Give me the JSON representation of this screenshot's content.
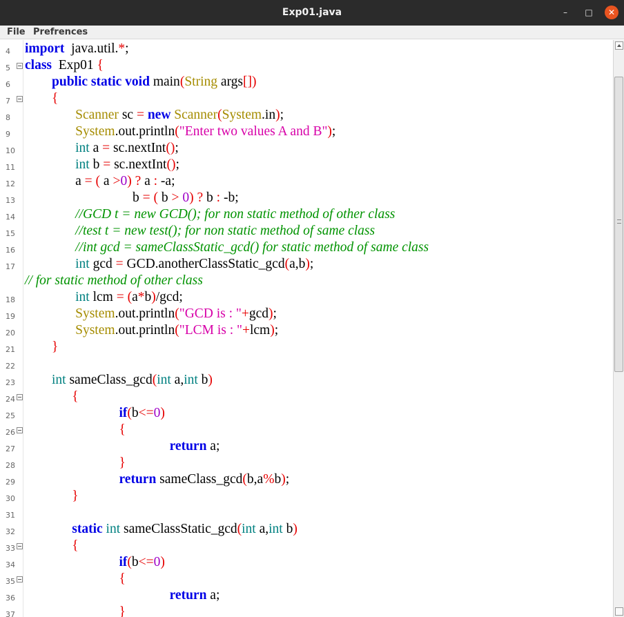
{
  "window": {
    "title": "Exp01.java",
    "minimize_glyph": "–",
    "maximize_glyph": "□",
    "close_glyph": "✕",
    "close_color": "#e95420"
  },
  "menu": {
    "file": "File",
    "prefs": "Prefrences"
  },
  "syntax_colors": {
    "keyword": "#0000e6",
    "type": "#008080",
    "class": "#a58c00",
    "symbol": "#e60000",
    "string": "#d700a8",
    "number": "#9e00c7",
    "comment": "#009300"
  },
  "lines": [
    {
      "num": "4",
      "fold": false,
      "tokens": [
        [
          "kw",
          "import"
        ],
        [
          "",
          "  java.util."
        ],
        [
          "sym",
          "*"
        ],
        [
          "",
          ";"
        ]
      ]
    },
    {
      "num": "5",
      "fold": true,
      "tokens": [
        [
          "kw",
          "class"
        ],
        [
          "",
          "  Exp01 "
        ],
        [
          "sym",
          "{"
        ]
      ]
    },
    {
      "num": "6",
      "fold": false,
      "tokens": [
        [
          "",
          "        "
        ],
        [
          "kw",
          "public static void"
        ],
        [
          "",
          " main"
        ],
        [
          "sym",
          "("
        ],
        [
          "cls",
          "String"
        ],
        [
          "",
          " args"
        ],
        [
          "sym",
          "[])"
        ]
      ]
    },
    {
      "num": "7",
      "fold": true,
      "tokens": [
        [
          "",
          "        "
        ],
        [
          "sym",
          "{"
        ]
      ]
    },
    {
      "num": "8",
      "fold": false,
      "tokens": [
        [
          "",
          "               "
        ],
        [
          "cls",
          "Scanner"
        ],
        [
          "",
          " sc "
        ],
        [
          "sym",
          "="
        ],
        [
          "",
          " "
        ],
        [
          "kw",
          "new"
        ],
        [
          "",
          " "
        ],
        [
          "cls",
          "Scanner"
        ],
        [
          "sym",
          "("
        ],
        [
          "cls",
          "System"
        ],
        [
          "",
          ".in"
        ],
        [
          "sym",
          ")"
        ],
        [
          "",
          ";"
        ]
      ]
    },
    {
      "num": "9",
      "fold": false,
      "tokens": [
        [
          "",
          "               "
        ],
        [
          "cls",
          "System"
        ],
        [
          "",
          ".out.println"
        ],
        [
          "sym",
          "("
        ],
        [
          "str",
          "\"Enter two values A and B\""
        ],
        [
          "sym",
          ")"
        ],
        [
          "",
          ";"
        ]
      ]
    },
    {
      "num": "10",
      "fold": false,
      "tokens": [
        [
          "",
          "               "
        ],
        [
          "ty",
          "int"
        ],
        [
          "",
          " a "
        ],
        [
          "sym",
          "="
        ],
        [
          "",
          " sc.nextInt"
        ],
        [
          "sym",
          "()"
        ],
        [
          "",
          ";"
        ]
      ]
    },
    {
      "num": "11",
      "fold": false,
      "tokens": [
        [
          "",
          "               "
        ],
        [
          "ty",
          "int"
        ],
        [
          "",
          " b "
        ],
        [
          "sym",
          "="
        ],
        [
          "",
          " sc.nextInt"
        ],
        [
          "sym",
          "()"
        ],
        [
          "",
          ";"
        ]
      ]
    },
    {
      "num": "12",
      "fold": false,
      "tokens": [
        [
          "",
          "               a "
        ],
        [
          "sym",
          "="
        ],
        [
          "",
          " "
        ],
        [
          "sym",
          "("
        ],
        [
          "",
          " a "
        ],
        [
          "sym",
          ">"
        ],
        [
          " ",
          ""
        ],
        [
          "num",
          "0"
        ],
        [
          "sym",
          ")"
        ],
        [
          "",
          " "
        ],
        [
          "sym",
          "?"
        ],
        [
          "",
          " a "
        ],
        [
          "sym",
          ":"
        ],
        [
          "",
          " -a;"
        ]
      ]
    },
    {
      "num": "13",
      "fold": false,
      "tokens": [
        [
          "",
          "                                b "
        ],
        [
          "sym",
          "="
        ],
        [
          "",
          " "
        ],
        [
          "sym",
          "("
        ],
        [
          "",
          " b "
        ],
        [
          "sym",
          ">"
        ],
        [
          "",
          " "
        ],
        [
          "num",
          "0"
        ],
        [
          "sym",
          ")"
        ],
        [
          "",
          " "
        ],
        [
          "sym",
          "?"
        ],
        [
          "",
          " b "
        ],
        [
          "sym",
          ":"
        ],
        [
          "",
          " -b;"
        ]
      ]
    },
    {
      "num": "14",
      "fold": false,
      "tokens": [
        [
          "",
          "               "
        ],
        [
          "cm",
          "//GCD t = new GCD(); for non static method of other class"
        ]
      ]
    },
    {
      "num": "15",
      "fold": false,
      "tokens": [
        [
          "",
          "               "
        ],
        [
          "cm",
          "//test t = new test(); for non static method of same class"
        ]
      ]
    },
    {
      "num": "16",
      "fold": false,
      "tokens": [
        [
          "",
          "               "
        ],
        [
          "cm",
          "//int gcd = sameClassStatic_gcd() for static method of same class"
        ]
      ]
    },
    {
      "num": "17",
      "fold": false,
      "tokens": [
        [
          "",
          "               "
        ],
        [
          "ty",
          "int"
        ],
        [
          "",
          " gcd "
        ],
        [
          "sym",
          "="
        ],
        [
          "",
          " GCD.anotherClassStatic_gcd"
        ],
        [
          "sym",
          "("
        ],
        [
          "",
          "a,b"
        ],
        [
          "sym",
          ")"
        ],
        [
          "",
          ";"
        ]
      ]
    },
    {
      "num": "",
      "fold": false,
      "wrap": true,
      "tokens": [
        [
          "cm",
          "// for static method of other class"
        ]
      ]
    },
    {
      "num": "18",
      "fold": false,
      "tokens": [
        [
          "",
          "               "
        ],
        [
          "ty",
          "int"
        ],
        [
          "",
          " lcm "
        ],
        [
          "sym",
          "="
        ],
        [
          "",
          " "
        ],
        [
          "sym",
          "("
        ],
        [
          "",
          "a"
        ],
        [
          "sym",
          "*"
        ],
        [
          "",
          "b"
        ],
        [
          "sym",
          ")"
        ],
        [
          "",
          "/gcd;"
        ]
      ]
    },
    {
      "num": "19",
      "fold": false,
      "tokens": [
        [
          "",
          "               "
        ],
        [
          "cls",
          "System"
        ],
        [
          "",
          ".out.println"
        ],
        [
          "sym",
          "("
        ],
        [
          "str",
          "\"GCD is : \""
        ],
        [
          "sym",
          "+"
        ],
        [
          "",
          "gcd"
        ],
        [
          "sym",
          ")"
        ],
        [
          "",
          ";"
        ]
      ]
    },
    {
      "num": "20",
      "fold": false,
      "tokens": [
        [
          "",
          "               "
        ],
        [
          "cls",
          "System"
        ],
        [
          "",
          ".out.println"
        ],
        [
          "sym",
          "("
        ],
        [
          "str",
          "\"LCM is : \""
        ],
        [
          "sym",
          "+"
        ],
        [
          "",
          "lcm"
        ],
        [
          "sym",
          ")"
        ],
        [
          "",
          ";"
        ]
      ]
    },
    {
      "num": "21",
      "fold": false,
      "tokens": [
        [
          "",
          "        "
        ],
        [
          "sym",
          "}"
        ]
      ]
    },
    {
      "num": "22",
      "fold": false,
      "tokens": []
    },
    {
      "num": "23",
      "fold": false,
      "tokens": [
        [
          "",
          "        "
        ],
        [
          "ty",
          "int"
        ],
        [
          "",
          " sameClass_gcd"
        ],
        [
          "sym",
          "("
        ],
        [
          "ty",
          "int"
        ],
        [
          "",
          " a,"
        ],
        [
          "ty",
          "int"
        ],
        [
          "",
          " b"
        ],
        [
          "sym",
          ")"
        ]
      ]
    },
    {
      "num": "24",
      "fold": true,
      "tokens": [
        [
          "",
          "              "
        ],
        [
          "sym",
          "{"
        ]
      ]
    },
    {
      "num": "25",
      "fold": false,
      "tokens": [
        [
          "",
          "                            "
        ],
        [
          "kw",
          "if"
        ],
        [
          "sym",
          "("
        ],
        [
          "",
          "b"
        ],
        [
          "sym",
          "<="
        ],
        [
          "num",
          "0"
        ],
        [
          "sym",
          ")"
        ]
      ]
    },
    {
      "num": "26",
      "fold": true,
      "tokens": [
        [
          "",
          "                            "
        ],
        [
          "sym",
          "{"
        ]
      ]
    },
    {
      "num": "27",
      "fold": false,
      "tokens": [
        [
          "",
          "                                           "
        ],
        [
          "kw",
          "return"
        ],
        [
          "",
          " a;"
        ]
      ]
    },
    {
      "num": "28",
      "fold": false,
      "tokens": [
        [
          "",
          "                            "
        ],
        [
          "sym",
          "}"
        ]
      ]
    },
    {
      "num": "29",
      "fold": false,
      "tokens": [
        [
          "",
          "                            "
        ],
        [
          "kw",
          "return"
        ],
        [
          "",
          " sameClass_gcd"
        ],
        [
          "sym",
          "("
        ],
        [
          "",
          "b,a"
        ],
        [
          "sym",
          "%"
        ],
        [
          "",
          "b"
        ],
        [
          "sym",
          ")"
        ],
        [
          "",
          ";"
        ]
      ]
    },
    {
      "num": "30",
      "fold": false,
      "tokens": [
        [
          "",
          "              "
        ],
        [
          "sym",
          "}"
        ]
      ]
    },
    {
      "num": "31",
      "fold": false,
      "tokens": []
    },
    {
      "num": "32",
      "fold": false,
      "tokens": [
        [
          "",
          "              "
        ],
        [
          "kw",
          "static"
        ],
        [
          "",
          " "
        ],
        [
          "ty",
          "int"
        ],
        [
          "",
          " sameClassStatic_gcd"
        ],
        [
          "sym",
          "("
        ],
        [
          "ty",
          "int"
        ],
        [
          "",
          " a,"
        ],
        [
          "ty",
          "int"
        ],
        [
          "",
          " b"
        ],
        [
          "sym",
          ")"
        ]
      ]
    },
    {
      "num": "33",
      "fold": true,
      "tokens": [
        [
          "",
          "              "
        ],
        [
          "sym",
          "{"
        ]
      ]
    },
    {
      "num": "34",
      "fold": false,
      "tokens": [
        [
          "",
          "                            "
        ],
        [
          "kw",
          "if"
        ],
        [
          "sym",
          "("
        ],
        [
          "",
          "b"
        ],
        [
          "sym",
          "<="
        ],
        [
          "num",
          "0"
        ],
        [
          "sym",
          ")"
        ]
      ]
    },
    {
      "num": "35",
      "fold": true,
      "tokens": [
        [
          "",
          "                            "
        ],
        [
          "sym",
          "{"
        ]
      ]
    },
    {
      "num": "36",
      "fold": false,
      "tokens": [
        [
          "",
          "                                           "
        ],
        [
          "kw",
          "return"
        ],
        [
          "",
          " a;"
        ]
      ]
    },
    {
      "num": "37",
      "fold": false,
      "tokens": [
        [
          "",
          "                            "
        ],
        [
          "sym",
          "}"
        ]
      ]
    }
  ]
}
